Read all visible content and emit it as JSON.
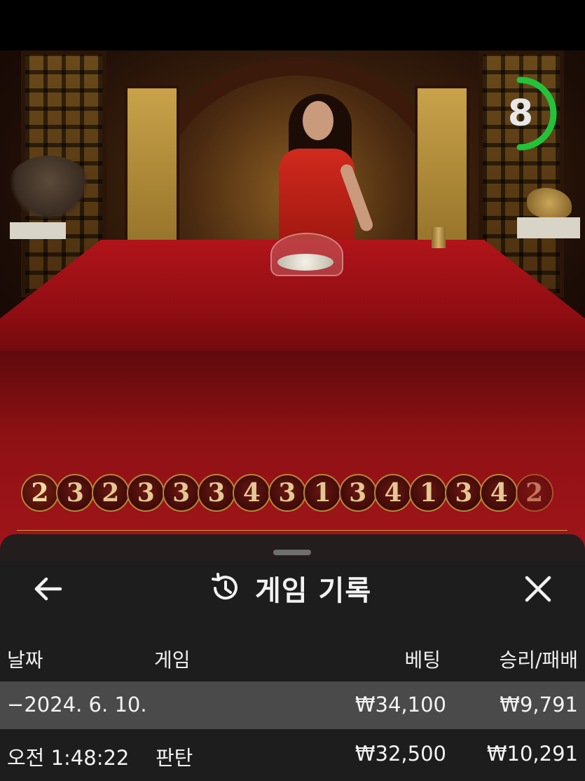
{
  "game": {
    "countdown": "8",
    "countdown_progress": 0.5,
    "results": [
      "2",
      "3",
      "2",
      "3",
      "3",
      "3",
      "4",
      "3",
      "1",
      "3",
      "4",
      "1",
      "3",
      "4",
      "2"
    ]
  },
  "history_sheet": {
    "title": "게임 기록",
    "back_icon": "arrow-left-icon",
    "title_icon": "history-icon",
    "close_icon": "close-icon",
    "columns": {
      "date": "날짜",
      "game": "게임",
      "bet": "베팅",
      "result": "승리/패배"
    },
    "group_row": {
      "toggle": "−",
      "date": "2024. 6. 10.",
      "bet": "₩34,100",
      "result": "₩9,791"
    },
    "detail_row": {
      "time": "오전 1:48:22",
      "game": "판탄",
      "bet": "₩32,500",
      "result": "₩10,291"
    }
  },
  "colors": {
    "timer_ring": "#22c33a",
    "sheet_bg": "#1e1e1e",
    "group_row_bg": "#4a4a4a",
    "ball_gold": "#e3c893"
  }
}
